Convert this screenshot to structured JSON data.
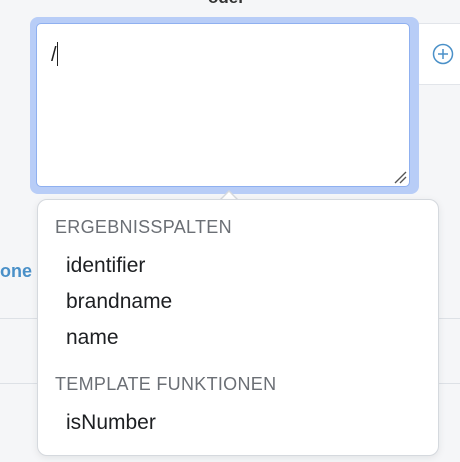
{
  "header": {
    "label": "oder"
  },
  "left_link": {
    "text": "one"
  },
  "editor": {
    "value": "/"
  },
  "autocomplete": {
    "sections": [
      {
        "title": "ERGEBNISSPALTEN",
        "items": [
          "identifier",
          "brandname",
          "name"
        ]
      },
      {
        "title": "TEMPLATE FUNKTIONEN",
        "items": [
          "isNumber"
        ]
      }
    ]
  },
  "icons": {
    "add": "plus-circle-icon",
    "resize": "resize-grip-icon"
  },
  "colors": {
    "focus_ring": "#b8cdf7",
    "link": "#4a90c8",
    "section_title": "#6b6f75"
  }
}
